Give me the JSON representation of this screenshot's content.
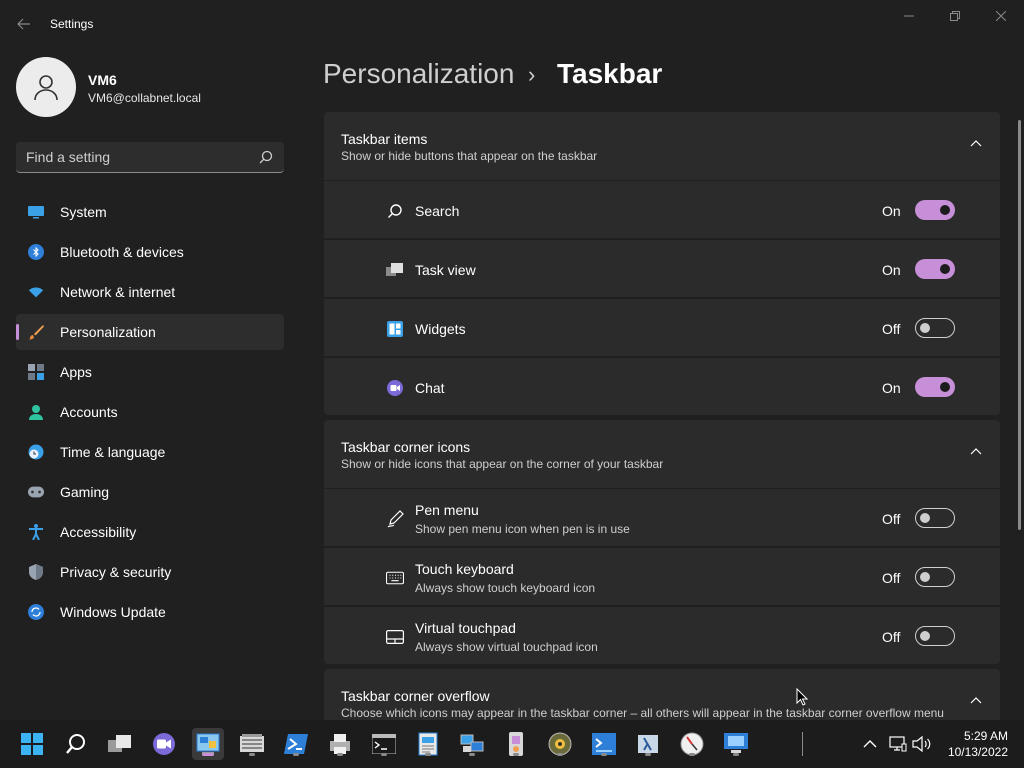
{
  "window": {
    "title": "Settings"
  },
  "profile": {
    "name": "VM6",
    "email": "VM6@collabnet.local"
  },
  "search": {
    "placeholder": "Find a setting"
  },
  "nav": [
    {
      "label": "System",
      "icon": "monitor-icon"
    },
    {
      "label": "Bluetooth & devices",
      "icon": "bluetooth-icon"
    },
    {
      "label": "Network & internet",
      "icon": "wifi-icon"
    },
    {
      "label": "Personalization",
      "icon": "brush-icon",
      "active": true
    },
    {
      "label": "Apps",
      "icon": "apps-icon"
    },
    {
      "label": "Accounts",
      "icon": "person-icon"
    },
    {
      "label": "Time & language",
      "icon": "clock-globe-icon"
    },
    {
      "label": "Gaming",
      "icon": "gamepad-icon"
    },
    {
      "label": "Accessibility",
      "icon": "accessibility-icon"
    },
    {
      "label": "Privacy & security",
      "icon": "shield-icon"
    },
    {
      "label": "Windows Update",
      "icon": "update-icon"
    }
  ],
  "breadcrumb": {
    "parent": "Personalization",
    "separator": "›",
    "current": "Taskbar"
  },
  "groups": {
    "taskbar_items": {
      "title": "Taskbar items",
      "subtitle": "Show or hide buttons that appear on the taskbar",
      "rows": [
        {
          "title": "Search",
          "state": "On",
          "on": true
        },
        {
          "title": "Task view",
          "state": "On",
          "on": true
        },
        {
          "title": "Widgets",
          "state": "Off",
          "on": false
        },
        {
          "title": "Chat",
          "state": "On",
          "on": true
        }
      ]
    },
    "corner_icons": {
      "title": "Taskbar corner icons",
      "subtitle": "Show or hide icons that appear on the corner of your taskbar",
      "rows": [
        {
          "title": "Pen menu",
          "subtitle": "Show pen menu icon when pen is in use",
          "state": "Off",
          "on": false
        },
        {
          "title": "Touch keyboard",
          "subtitle": "Always show touch keyboard icon",
          "state": "Off",
          "on": false
        },
        {
          "title": "Virtual touchpad",
          "subtitle": "Always show virtual touchpad icon",
          "state": "Off",
          "on": false
        }
      ]
    },
    "corner_overflow": {
      "title": "Taskbar corner overflow",
      "subtitle": "Choose which icons may appear in the taskbar corner – all others will appear in the taskbar corner overflow menu"
    }
  },
  "taskbar": {
    "clock_time": "5:29 AM",
    "clock_date": "10/13/2022"
  },
  "colors": {
    "accent": "#c78fd8",
    "background": "#202020",
    "card": "#2b2b2b"
  }
}
